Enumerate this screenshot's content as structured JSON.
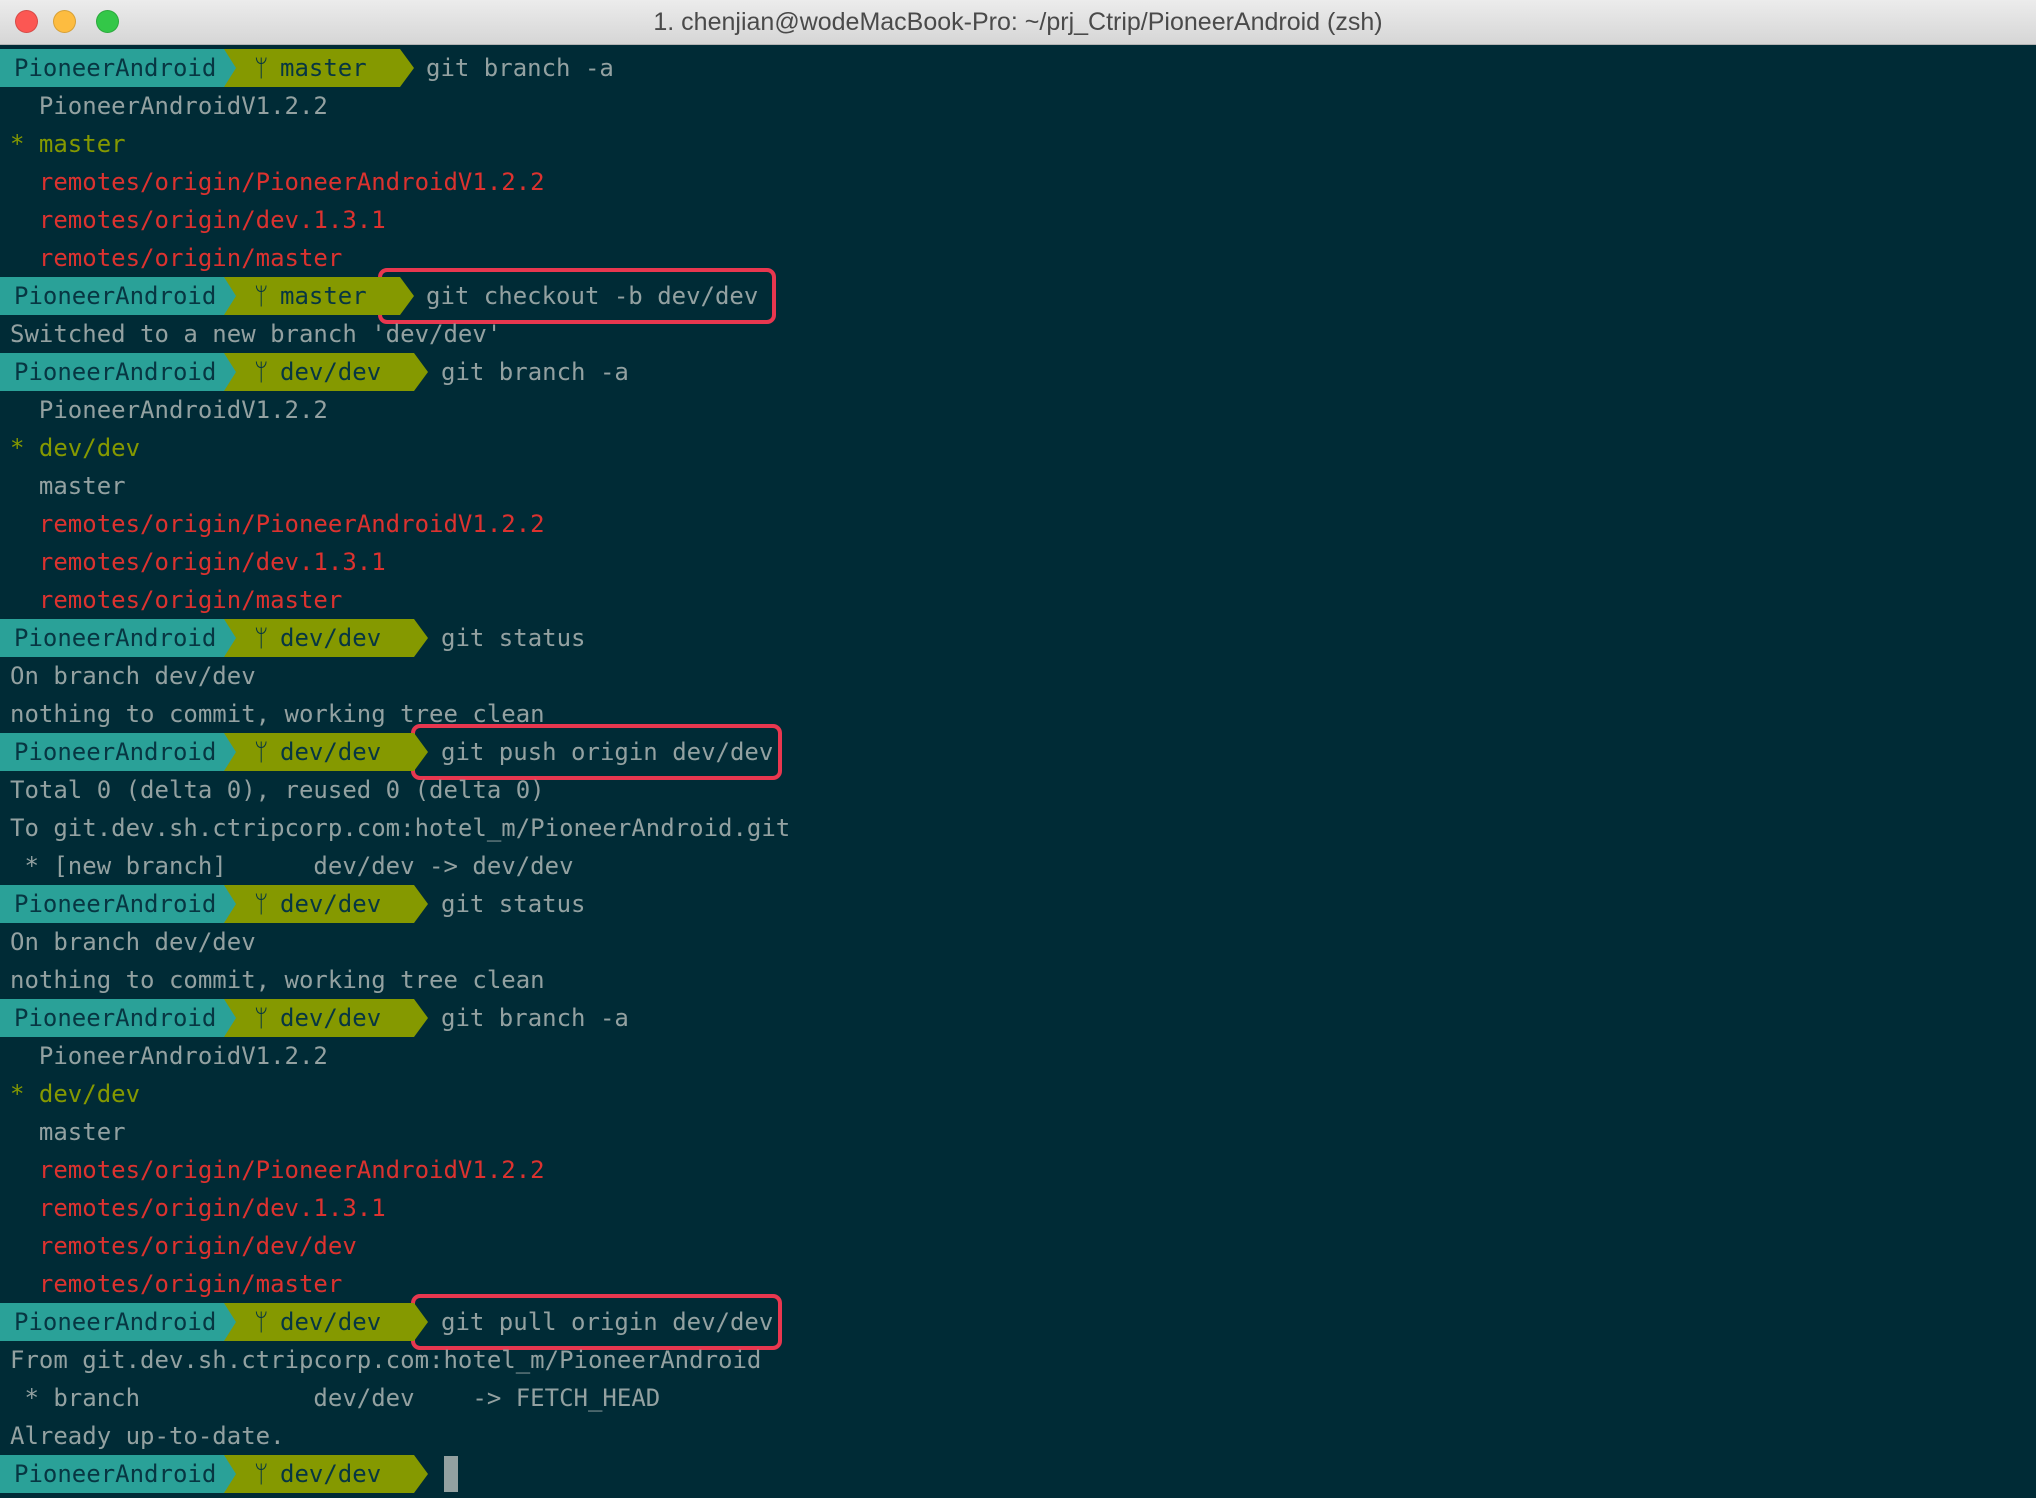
{
  "window": {
    "title": "1. chenjian@wodeMacBook-Pro: ~/prj_Ctrip/PioneerAndroid (zsh)",
    "traffic_lights": {
      "close": "#fc5753",
      "minimize": "#fdbc40",
      "zoom": "#33c748"
    }
  },
  "prompt": {
    "dir": "PioneerAndroid",
    "branch_icon": ""
  },
  "lines": [
    {
      "t": "p",
      "branch": "master",
      "cmd": "git branch -a"
    },
    {
      "t": "o",
      "c": "default",
      "text": "  PioneerAndroidV1.2.2"
    },
    {
      "t": "o",
      "c": "current",
      "text": "* master"
    },
    {
      "t": "o",
      "c": "remote",
      "text": "  remotes/origin/PioneerAndroidV1.2.2"
    },
    {
      "t": "o",
      "c": "remote",
      "text": "  remotes/origin/dev.1.3.1"
    },
    {
      "t": "o",
      "c": "remote",
      "text": "  remotes/origin/master"
    },
    {
      "t": "p",
      "branch": "master",
      "cmd": "git checkout -b dev/dev",
      "hl": true
    },
    {
      "t": "o",
      "c": "default",
      "text": "Switched to a new branch 'dev/dev'"
    },
    {
      "t": "p",
      "branch": "dev/dev",
      "cmd": "git branch -a"
    },
    {
      "t": "o",
      "c": "default",
      "text": "  PioneerAndroidV1.2.2"
    },
    {
      "t": "o",
      "c": "current",
      "text": "* dev/dev"
    },
    {
      "t": "o",
      "c": "default",
      "text": "  master"
    },
    {
      "t": "o",
      "c": "remote",
      "text": "  remotes/origin/PioneerAndroidV1.2.2"
    },
    {
      "t": "o",
      "c": "remote",
      "text": "  remotes/origin/dev.1.3.1"
    },
    {
      "t": "o",
      "c": "remote",
      "text": "  remotes/origin/master"
    },
    {
      "t": "p",
      "branch": "dev/dev",
      "cmd": "git status"
    },
    {
      "t": "o",
      "c": "default",
      "text": "On branch dev/dev"
    },
    {
      "t": "o",
      "c": "default",
      "text": "nothing to commit, working tree clean"
    },
    {
      "t": "p",
      "branch": "dev/dev",
      "cmd": "git push origin dev/dev",
      "hl": true
    },
    {
      "t": "o",
      "c": "default",
      "text": "Total 0 (delta 0), reused 0 (delta 0)"
    },
    {
      "t": "o",
      "c": "default",
      "text": "To git.dev.sh.ctripcorp.com:hotel_m/PioneerAndroid.git"
    },
    {
      "t": "o",
      "c": "default",
      "text": " * [new branch]      dev/dev -> dev/dev"
    },
    {
      "t": "p",
      "branch": "dev/dev",
      "cmd": "git status"
    },
    {
      "t": "o",
      "c": "default",
      "text": "On branch dev/dev"
    },
    {
      "t": "o",
      "c": "default",
      "text": "nothing to commit, working tree clean"
    },
    {
      "t": "p",
      "branch": "dev/dev",
      "cmd": "git branch -a"
    },
    {
      "t": "o",
      "c": "default",
      "text": "  PioneerAndroidV1.2.2"
    },
    {
      "t": "o",
      "c": "current",
      "text": "* dev/dev"
    },
    {
      "t": "o",
      "c": "default",
      "text": "  master"
    },
    {
      "t": "o",
      "c": "remote",
      "text": "  remotes/origin/PioneerAndroidV1.2.2"
    },
    {
      "t": "o",
      "c": "remote",
      "text": "  remotes/origin/dev.1.3.1"
    },
    {
      "t": "o",
      "c": "remote",
      "text": "  remotes/origin/dev/dev"
    },
    {
      "t": "o",
      "c": "remote",
      "text": "  remotes/origin/master"
    },
    {
      "t": "p",
      "branch": "dev/dev",
      "cmd": "git pull origin dev/dev",
      "hl": true
    },
    {
      "t": "o",
      "c": "default",
      "text": "From git.dev.sh.ctripcorp.com:hotel_m/PioneerAndroid"
    },
    {
      "t": "o",
      "c": "default",
      "text": " * branch            dev/dev    -> FETCH_HEAD"
    },
    {
      "t": "o",
      "c": "default",
      "text": "Already up-to-date."
    },
    {
      "t": "p",
      "branch": "dev/dev",
      "cmd": ""
    }
  ]
}
